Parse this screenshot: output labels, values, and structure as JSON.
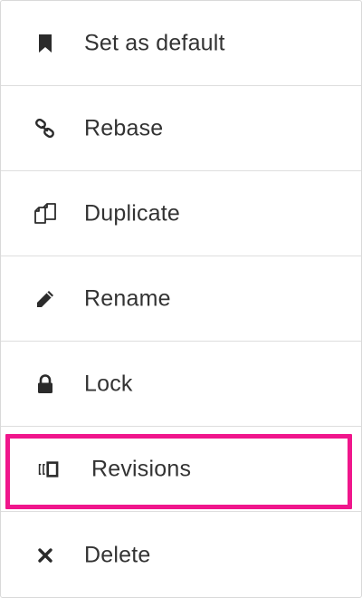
{
  "menu": {
    "items": [
      {
        "label": "Set as default",
        "icon": "bookmark-icon"
      },
      {
        "label": "Rebase",
        "icon": "link-icon"
      },
      {
        "label": "Duplicate",
        "icon": "duplicate-icon"
      },
      {
        "label": "Rename",
        "icon": "pencil-icon"
      },
      {
        "label": "Lock",
        "icon": "lock-icon"
      },
      {
        "label": "Revisions",
        "icon": "revisions-icon",
        "highlighted": true
      },
      {
        "label": "Delete",
        "icon": "close-icon"
      }
    ]
  },
  "colors": {
    "text": "#333333",
    "icon": "#2b2b2b",
    "divider": "#dedede",
    "highlight": "#f0168c"
  }
}
